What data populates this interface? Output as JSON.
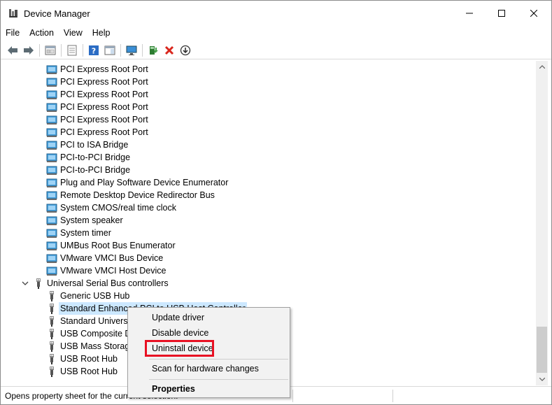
{
  "window": {
    "title": "Device Manager",
    "controls": {
      "minimize": "minimize",
      "maximize": "maximize",
      "close": "close"
    }
  },
  "menubar": {
    "items": [
      "File",
      "Action",
      "View",
      "Help"
    ]
  },
  "toolbar": {
    "buttons": [
      "back-arrow-icon",
      "forward-arrow-icon",
      "show-hide-console-tree-icon",
      "properties-sheet-icon",
      "help-icon",
      "action-pane-icon",
      "monitor-icon",
      "update-driver-icon",
      "uninstall-x-icon",
      "download-circle-icon"
    ]
  },
  "tree": {
    "system_devices": [
      "PCI Express Root Port",
      "PCI Express Root Port",
      "PCI Express Root Port",
      "PCI Express Root Port",
      "PCI Express Root Port",
      "PCI Express Root Port",
      "PCI to ISA Bridge",
      "PCI-to-PCI Bridge",
      "PCI-to-PCI Bridge",
      "Plug and Play Software Device Enumerator",
      "Remote Desktop Device Redirector Bus",
      "System CMOS/real time clock",
      "System speaker",
      "System timer",
      "UMBus Root Bus Enumerator",
      "VMware VMCI Bus Device",
      "VMware VMCI Host Device"
    ],
    "usb_category": "Universal Serial Bus controllers",
    "usb_devices": [
      "Generic USB Hub",
      "Standard Enhanced PCI to USB Host Controller",
      "Standard Universal PCI to USB Host Controller",
      "USB Composite Device",
      "USB Mass Storage Device",
      "USB Root Hub",
      "USB Root Hub"
    ],
    "selected_index": 1
  },
  "context_menu": {
    "items": [
      "Update driver",
      "Disable device",
      "Uninstall device",
      "Scan for hardware changes",
      "Properties"
    ],
    "highlighted": "Uninstall device",
    "highlight_color": "#e81123"
  },
  "statusbar": {
    "text": "Opens property sheet for the current selection."
  },
  "colors": {
    "selection": "#cce8ff",
    "menu_bg": "#f2f2f2",
    "accent_red": "#e81123"
  }
}
